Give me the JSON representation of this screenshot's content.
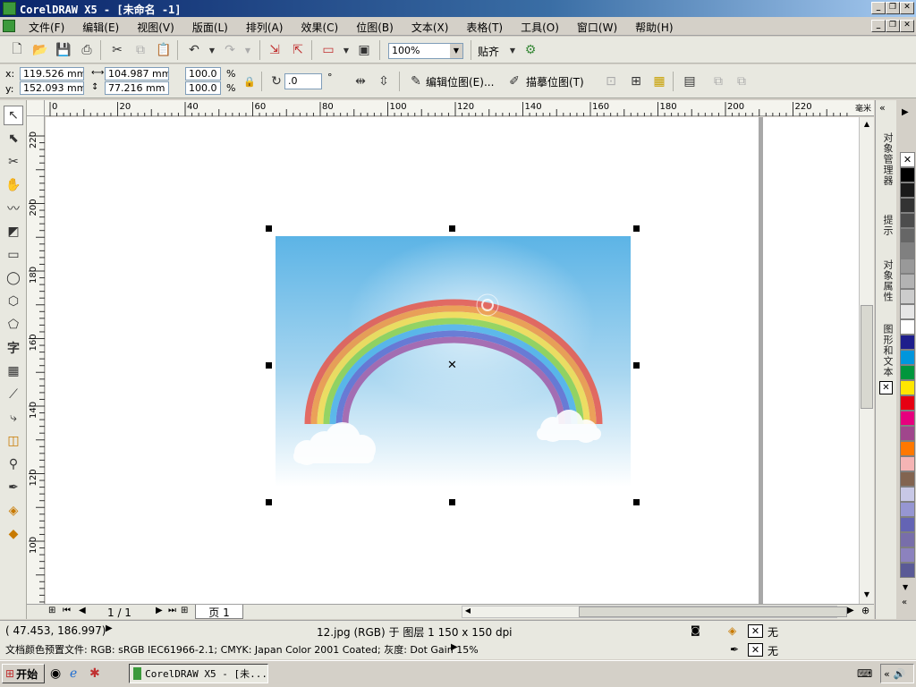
{
  "window": {
    "title": "CorelDRAW X5 - [未命名 -1]"
  },
  "menu": [
    "文件(F)",
    "编辑(E)",
    "视图(V)",
    "版面(L)",
    "排列(A)",
    "效果(C)",
    "位图(B)",
    "文本(X)",
    "表格(T)",
    "工具(O)",
    "窗口(W)",
    "帮助(H)"
  ],
  "toolbar": {
    "zoom_value": "100%",
    "snap_label": "贴齐"
  },
  "propbar": {
    "x_label": "x:",
    "x_value": "119.526 mm",
    "y_label": "y:",
    "y_value": "152.093 mm",
    "w_value": "104.987 mm",
    "h_value": "77.216 mm",
    "scale_w": "100.0",
    "scale_h": "100.0",
    "percent_sign": "%",
    "rotation_value": ".0",
    "degree_sign": "°",
    "edit_bitmap_label": "编辑位图(E)...",
    "trace_bitmap_label": "描摹位图(T)"
  },
  "ruler": {
    "h_ticks": [
      "0",
      "20",
      "40",
      "60",
      "80",
      "100",
      "120",
      "140",
      "160",
      "180",
      "200",
      "220"
    ],
    "v_ticks": [
      "220",
      "200",
      "180",
      "160",
      "140",
      "120",
      "100"
    ],
    "unit": "毫米"
  },
  "docker_tabs": [
    "对象管理器",
    "提示",
    "对象属性",
    "图形和文本"
  ],
  "palette_colors": [
    "#ffffff",
    "#000000",
    "#1a1a1a",
    "#333333",
    "#4d4d4d",
    "#666666",
    "#808080",
    "#999999",
    "#b3b3b3",
    "#cccccc",
    "#e6e6e6",
    "#ffffff",
    "#1e1e8c",
    "#0096dc",
    "#00963c",
    "#ffe600",
    "#e60012",
    "#e6007e",
    "#a0468c",
    "#ff7800",
    "#f5b4b4",
    "#826450",
    "#c8c8e6",
    "#9696d2",
    "#6464b4",
    "#786eaa",
    "#8c82be",
    "#5a5a96"
  ],
  "navigator": {
    "page_count": "1 / 1",
    "page_tab": "页 1"
  },
  "status": {
    "coords": "( 47.453, 186.997)",
    "object_info": "12.jpg (RGB) 于 图层 1 150 x 150 dpi",
    "color_profile": "文档颜色预置文件: RGB: sRGB IEC61966-2.1; CMYK: Japan Color 2001 Coated; 灰度: Dot Gain 15%",
    "fill_none": "无",
    "outline_none": "无"
  },
  "taskbar": {
    "start_label": "开始",
    "task_label": "CorelDRAW X5 - [未..."
  },
  "colors": {
    "sky_top": "#5cb4e6",
    "sky_bottom": "#ffffff",
    "title_bar": "#0a246a"
  }
}
